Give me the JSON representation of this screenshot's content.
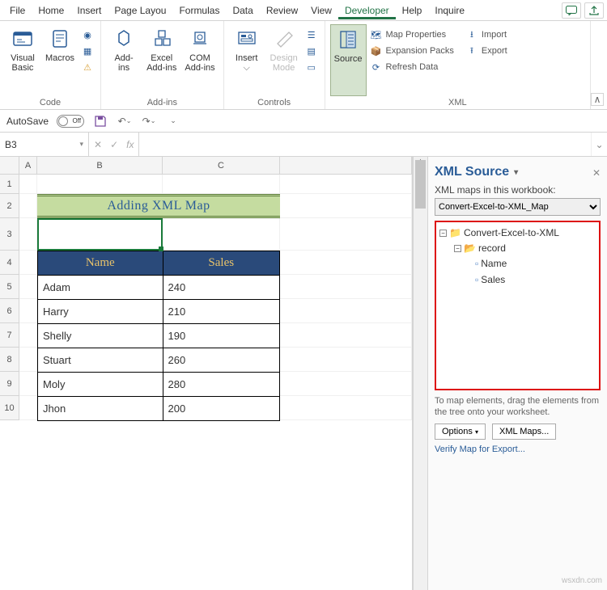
{
  "menu": {
    "items": [
      "File",
      "Home",
      "Insert",
      "Page Layou",
      "Formulas",
      "Data",
      "Review",
      "View",
      "Developer",
      "Help",
      "Inquire"
    ],
    "active": "Developer"
  },
  "ribbon": {
    "groups": {
      "code": {
        "label": "Code",
        "visual_basic": "Visual\nBasic",
        "macros": "Macros"
      },
      "addins": {
        "label": "Add-ins",
        "addins": "Add-\nins",
        "excel": "Excel\nAdd-ins",
        "com": "COM\nAdd-ins"
      },
      "controls": {
        "label": "Controls",
        "insert": "Insert",
        "design": "Design\nMode"
      },
      "xml": {
        "label": "XML",
        "source": "Source",
        "map_props": "Map Properties",
        "expansion": "Expansion Packs",
        "refresh": "Refresh Data",
        "import": "Import",
        "export": "Export"
      }
    }
  },
  "qat": {
    "autosave_label": "AutoSave",
    "autosave_state": "Off"
  },
  "fbar": {
    "namebox": "B3"
  },
  "sheet": {
    "cols": [
      "A",
      "B",
      "C"
    ],
    "rows": [
      "1",
      "2",
      "3",
      "4",
      "5",
      "6",
      "7",
      "8",
      "9",
      "10"
    ],
    "title": "Adding XML Map",
    "headers": {
      "name": "Name",
      "sales": "Sales"
    },
    "data": [
      {
        "name": "Adam",
        "sales": "240"
      },
      {
        "name": "Harry",
        "sales": "210"
      },
      {
        "name": "Shelly",
        "sales": "190"
      },
      {
        "name": "Stuart",
        "sales": "260"
      },
      {
        "name": "Moly",
        "sales": "280"
      },
      {
        "name": "Jhon",
        "sales": "200"
      }
    ]
  },
  "xmlpane": {
    "title": "XML Source",
    "maps_label": "XML maps in this workbook:",
    "selected_map": "Convert-Excel-to-XML_Map",
    "tree": {
      "root": "Convert-Excel-to-XML",
      "child": "record",
      "leaves": [
        "Name",
        "Sales"
      ]
    },
    "help": "To map elements, drag the elements from the tree onto your worksheet.",
    "options_btn": "Options",
    "maps_btn": "XML Maps...",
    "verify": "Verify Map for Export..."
  },
  "watermark": "wsxdn.com"
}
